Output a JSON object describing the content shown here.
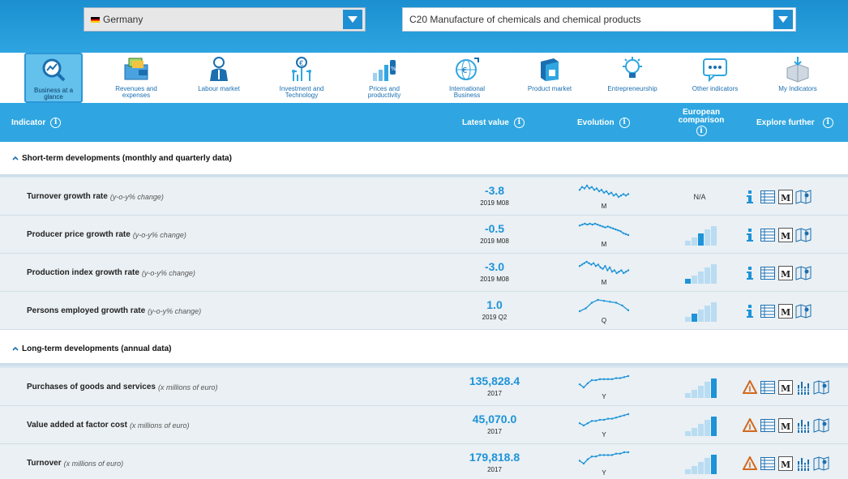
{
  "header": {
    "country": "Germany",
    "sector": "C20 Manufacture of chemicals and chemical products"
  },
  "nav": [
    {
      "label": "Business at a glance",
      "icon": "magnifier-chart-icon",
      "active": true
    },
    {
      "label": "Revenues and expenses",
      "icon": "money-wallet-icon"
    },
    {
      "label": "Labour market",
      "icon": "worker-icon"
    },
    {
      "label": "Investment and Technology",
      "icon": "circuit-euro-icon"
    },
    {
      "label": "Prices and productivity",
      "icon": "price-tag-chart-icon"
    },
    {
      "label": "International Business",
      "icon": "globe-euro-icon"
    },
    {
      "label": "Product market",
      "icon": "product-box-icon"
    },
    {
      "label": "Entrepreneurship",
      "icon": "lightbulb-icon"
    },
    {
      "label": "Other indicators",
      "icon": "speech-bubble-icon"
    },
    {
      "label": "My Indicators",
      "icon": "box-download-icon"
    }
  ],
  "table_header": {
    "indicator": "Indicator",
    "latest": "Latest value",
    "evolution": "Evolution",
    "european": "European comparison",
    "explore": "Explore further"
  },
  "sections": [
    {
      "title": "Short-term developments (monthly and quarterly data)"
    },
    {
      "title": "Long-term developments (annual data)"
    }
  ],
  "rows": [
    {
      "name": "Turnover growth rate",
      "unit": "(y-o-y% change)",
      "value": "-3.8",
      "period": "2019 M08",
      "freq": "M",
      "comparison": "N/A",
      "spark": [
        6,
        4,
        5,
        3,
        5,
        4,
        6,
        5,
        7,
        6,
        8,
        7,
        9,
        8,
        10,
        9,
        11,
        10,
        9,
        10,
        9
      ],
      "bars_level": 0
    },
    {
      "name": "Producer price growth rate",
      "unit": "(y-o-y% change)",
      "value": "-0.5",
      "period": "2019 M08",
      "freq": "M",
      "comparison": "",
      "spark": [
        4,
        3,
        2,
        3,
        2,
        3,
        2,
        3,
        4,
        5,
        6,
        5,
        6,
        7,
        8,
        9,
        10,
        12,
        13,
        14
      ],
      "bars_level": 3
    },
    {
      "name": "Production index growth rate",
      "unit": "(y-o-y% change)",
      "value": "-3.0",
      "period": "2019 M08",
      "freq": "M",
      "comparison": "",
      "spark": [
        6,
        5,
        4,
        3,
        4,
        5,
        4,
        6,
        5,
        7,
        8,
        6,
        9,
        7,
        10,
        9,
        11,
        10,
        9,
        11,
        10,
        9
      ],
      "bars_level": 1
    },
    {
      "name": "Persons employed growth rate",
      "unit": "(y-o-y% change)",
      "value": "1.0",
      "period": "2019 Q2",
      "freq": "Q",
      "comparison": "",
      "spark": [
        15,
        12,
        6,
        3,
        4,
        5,
        6,
        9,
        14
      ],
      "bars_level": 2
    },
    {
      "name": "Purchases of goods and services",
      "unit": "(x millions of euro)",
      "value": "135,828.4",
      "period": "2017",
      "freq": "Y",
      "comparison": "",
      "spark": [
        10,
        13,
        9,
        6,
        6,
        5,
        5,
        5,
        5,
        4,
        4,
        3,
        2
      ],
      "bars_level": 5
    },
    {
      "name": "Value added at factor cost",
      "unit": "(x millions of euro)",
      "value": "45,070.0",
      "period": "2017",
      "freq": "Y",
      "comparison": "",
      "spark": [
        9,
        11,
        9,
        7,
        7,
        6,
        6,
        5,
        5,
        4,
        3,
        2,
        1
      ],
      "bars_level": 5
    },
    {
      "name": "Turnover",
      "unit": "(x millions of euro)",
      "value": "179,818.8",
      "period": "2017",
      "freq": "Y",
      "comparison": "",
      "spark": [
        11,
        13,
        10,
        8,
        8,
        7,
        7,
        7,
        7,
        6,
        6,
        5,
        5
      ],
      "bars_level": 5
    }
  ],
  "colors": {
    "accent": "#2fa6e1",
    "value_blue": "#1d93d8",
    "warning_orange": "#d2691e"
  }
}
